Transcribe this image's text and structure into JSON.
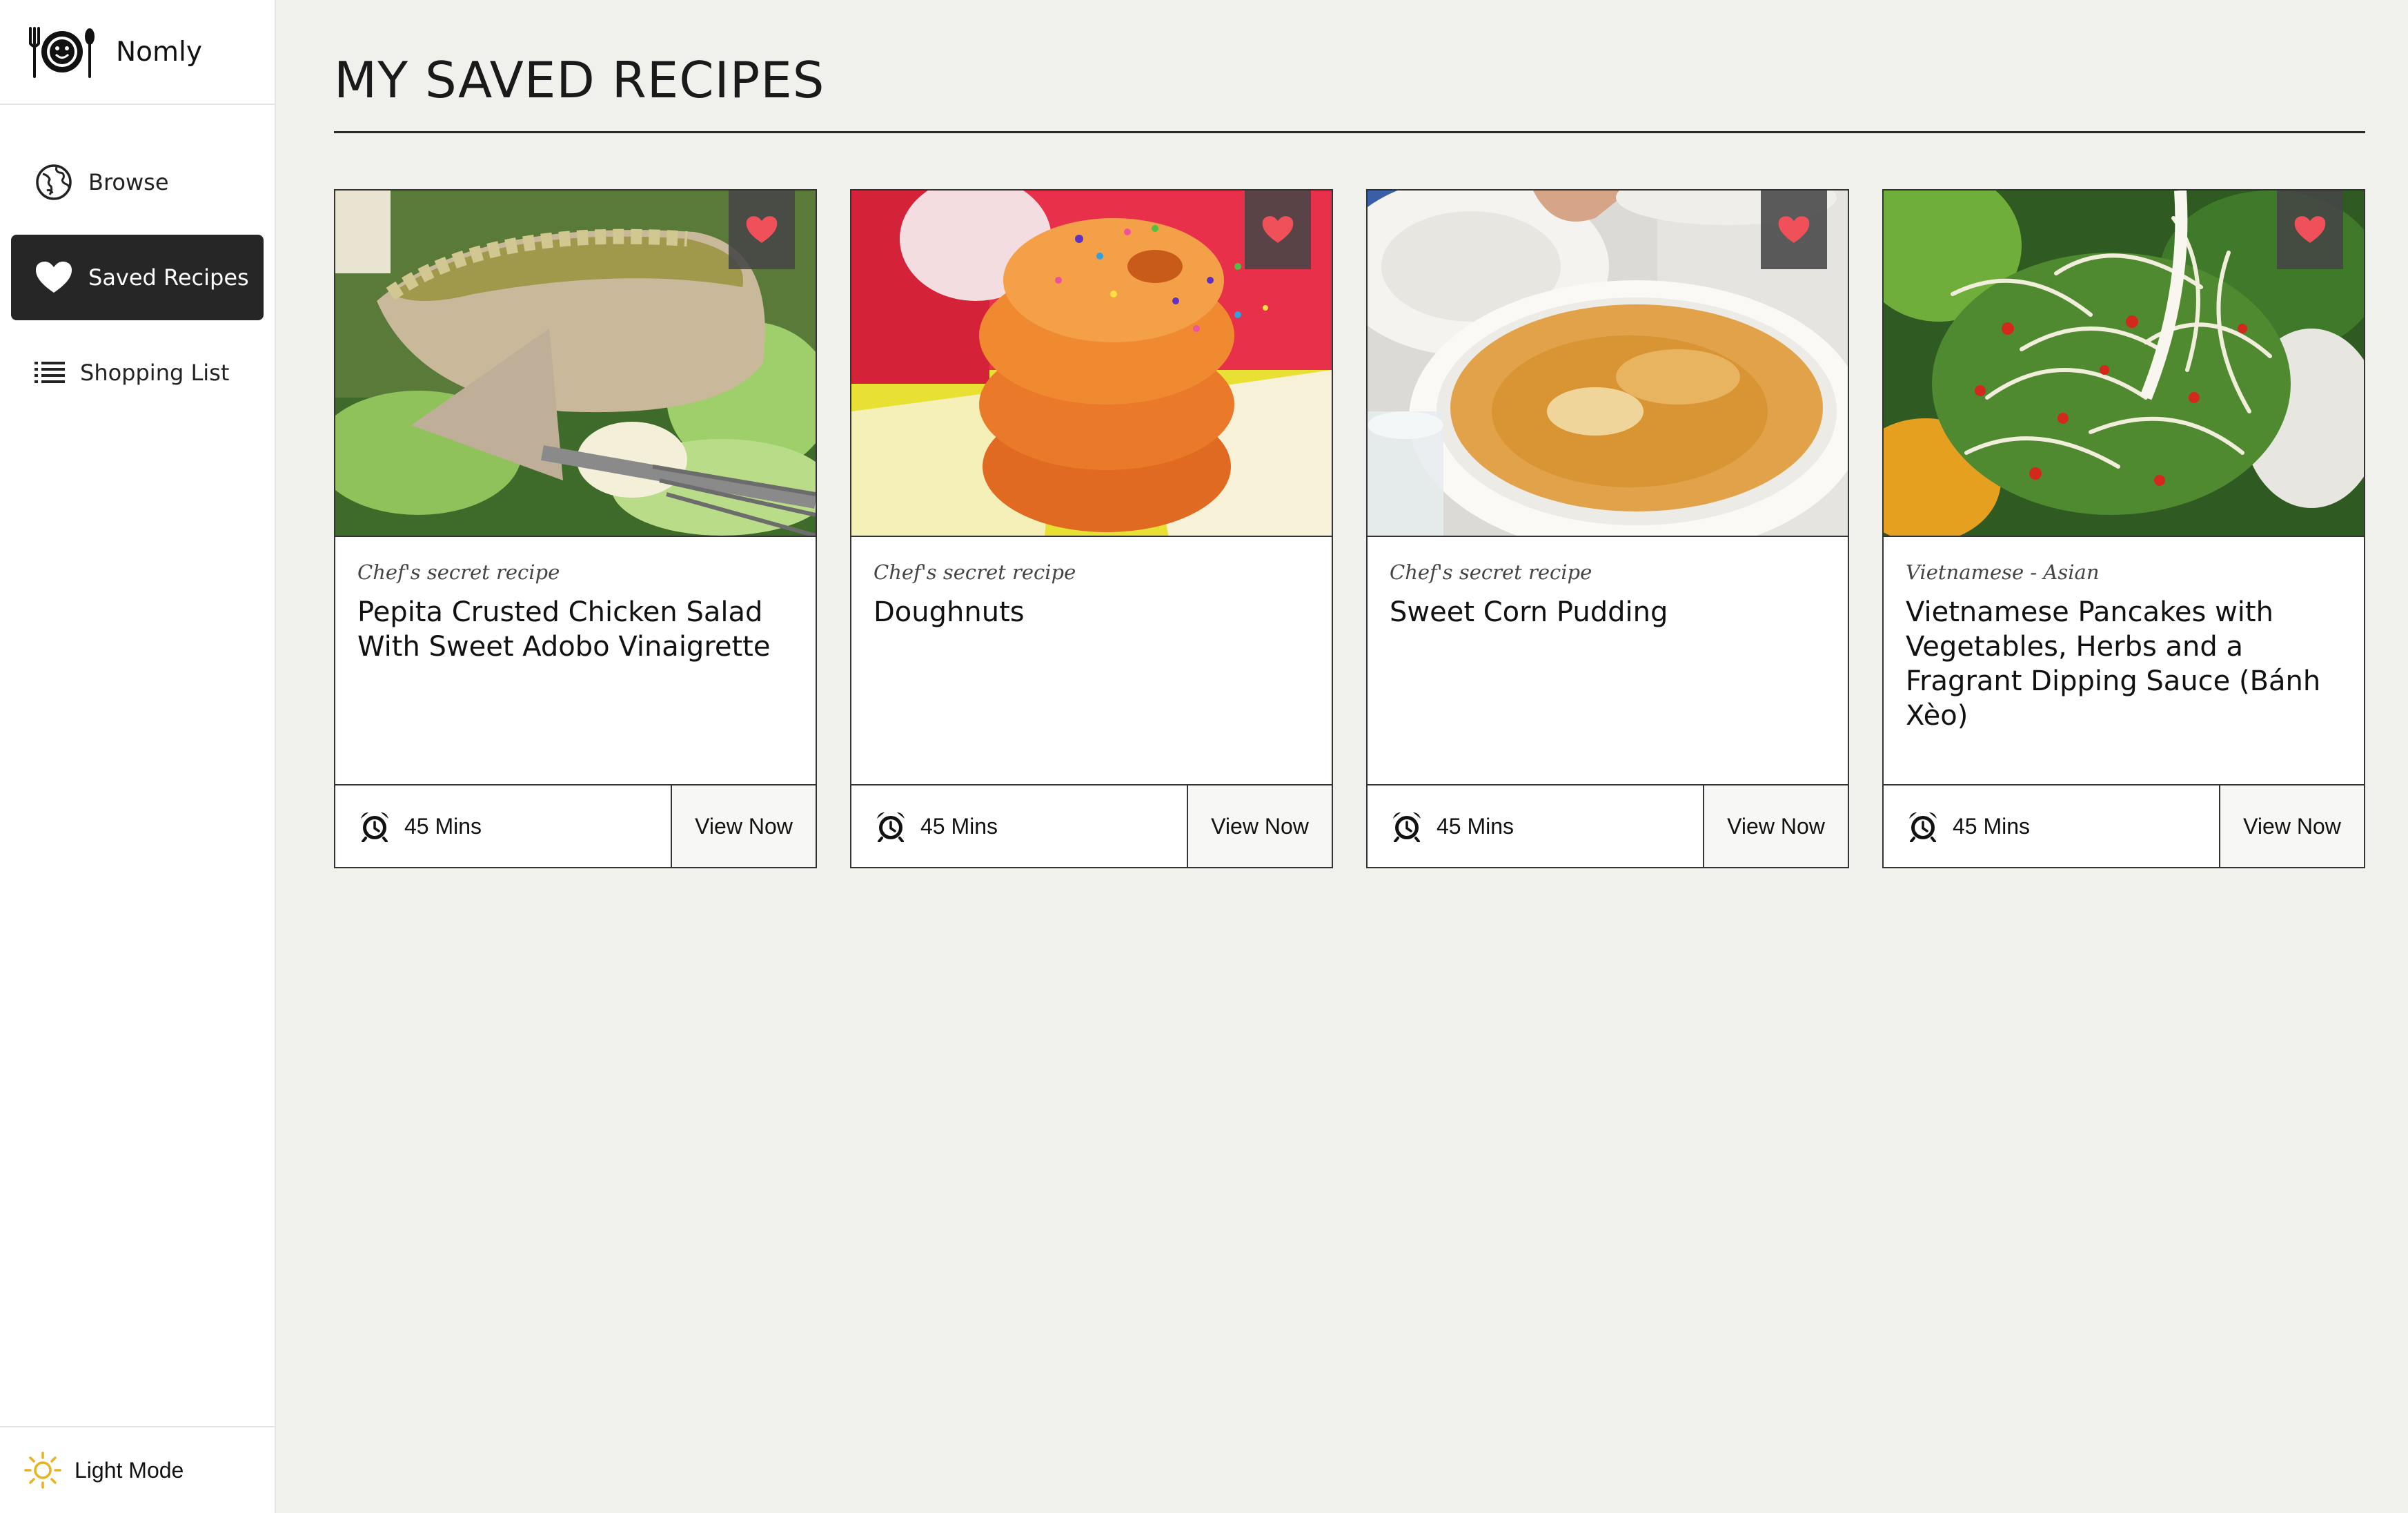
{
  "app": {
    "name": "Nomly",
    "logo_icon": "plate-fork-spoon-icon"
  },
  "sidebar": {
    "items": [
      {
        "label": "Browse",
        "icon": "globe-icon",
        "active": false
      },
      {
        "label": "Saved Recipes",
        "icon": "heart-icon",
        "active": true
      },
      {
        "label": "Shopping List",
        "icon": "list-icon",
        "active": false
      }
    ],
    "footer": {
      "label": "Light Mode",
      "icon": "sun-icon"
    }
  },
  "page": {
    "title": "MY SAVED RECIPES"
  },
  "recipes": [
    {
      "subtitle": "Chef's secret recipe",
      "title": "Pepita Crusted Chicken Salad With Sweet Adobo Vinaigrette",
      "time": "45 Mins",
      "action": "View Now",
      "saved": true,
      "image": "chicken-salad-photo"
    },
    {
      "subtitle": "Chef's secret recipe",
      "title": "Doughnuts",
      "time": "45 Mins",
      "action": "View Now",
      "saved": true,
      "image": "doughnuts-photo"
    },
    {
      "subtitle": "Chef's secret recipe",
      "title": "Sweet Corn Pudding",
      "time": "45 Mins",
      "action": "View Now",
      "saved": true,
      "image": "corn-pudding-photo"
    },
    {
      "subtitle": "Vietnamese - Asian",
      "title": "Vietnamese Pancakes with Vegetables, Herbs and a Fragrant Dipping Sauce (Bánh Xèo)",
      "time": "45 Mins",
      "action": "View Now",
      "saved": true,
      "image": "banh-xeo-photo"
    }
  ],
  "colors": {
    "accent_active": "#262626",
    "heart": "#f0505a",
    "background": "#f0f0ed",
    "sun": "#e8b320"
  }
}
